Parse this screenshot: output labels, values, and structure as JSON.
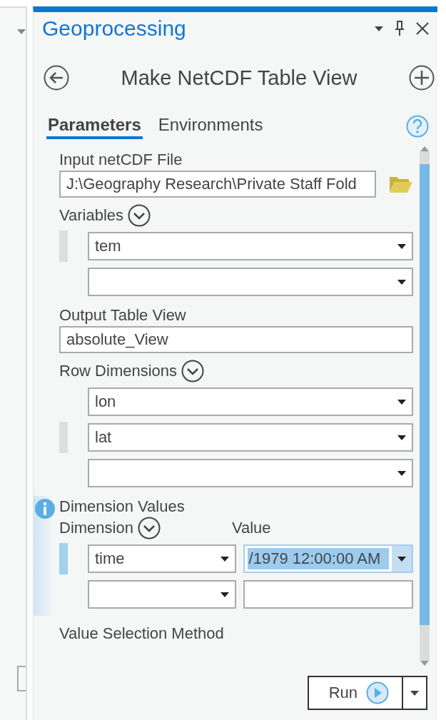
{
  "panel": {
    "title": "Geoprocessing"
  },
  "tool": {
    "title": "Make NetCDF Table View"
  },
  "tabs": [
    {
      "label": "Parameters",
      "selected": true
    },
    {
      "label": "Environments",
      "selected": false
    }
  ],
  "parameters": [
    {
      "kind": "file",
      "label": "Input netCDF File",
      "value": "J:\\Geography Research\\Private Staff Fold"
    },
    {
      "kind": "multi",
      "label": "Variables",
      "rows": [
        {
          "value": "tem",
          "current": true
        },
        {
          "value": "",
          "current": false
        }
      ]
    },
    {
      "kind": "text",
      "label": "Output Table View",
      "value": "absolute_View"
    },
    {
      "kind": "multi",
      "label": "Row Dimensions",
      "rows": [
        {
          "value": "lon",
          "current": false
        },
        {
          "value": "lat",
          "current": true
        },
        {
          "value": "",
          "current": false
        }
      ]
    },
    {
      "kind": "dimensions",
      "label": "Dimension Values",
      "dimension_header": "Dimension",
      "value_header": "Value",
      "rows": [
        {
          "dimension": "time",
          "value": "/1979 12:00:00 AM",
          "selected": true
        },
        {
          "dimension": "",
          "value": "",
          "selected": false
        }
      ]
    },
    {
      "kind": "label",
      "label": "Value Selection Method"
    }
  ],
  "run": {
    "label": "Run"
  }
}
